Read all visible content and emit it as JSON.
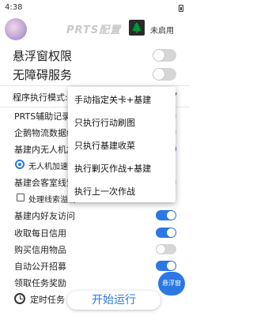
{
  "status_bar": {
    "time": "4:38"
  },
  "header": {
    "title": "PRTS配置",
    "status_label": "未启用"
  },
  "floating_window": {
    "label": "悬浮窗权限",
    "enabled": false
  },
  "accessibility": {
    "label": "无障碍服务",
    "enabled": false
  },
  "mode": {
    "label": "程序执行模式:"
  },
  "mode_menu": {
    "options": [
      "手动指定关卡+基建",
      "只执行行动刷图",
      "只执行基建收菜",
      "执行剿灭作战+基建",
      "执行上一次作战"
    ]
  },
  "settings": [
    {
      "label": "PRTS辅助记录",
      "enabled": false
    },
    {
      "label": "企鹅物流数据统",
      "enabled": false
    },
    {
      "label": "基建内无人机加",
      "enabled": true
    },
    {
      "label": "无人机加速生",
      "type": "radio"
    },
    {
      "label": "基建会客室线索",
      "enabled": false
    },
    {
      "label": "处理线索溢出",
      "type": "checkbox"
    },
    {
      "label": "基建内好友访问",
      "enabled": true
    },
    {
      "label": "收取每日信用",
      "enabled": true
    },
    {
      "label": "购买信用物品",
      "enabled": false
    },
    {
      "label": "自动公开招募",
      "enabled": true
    },
    {
      "label": "领取任务奖励",
      "enabled": false
    }
  ],
  "float_button": {
    "label": "悬浮窗"
  },
  "bottom": {
    "timer_label": "定时任务",
    "start_label": "开始运行"
  },
  "colors": {
    "accent": "#2b78e4",
    "toggle_off": "#d6d6d6"
  }
}
